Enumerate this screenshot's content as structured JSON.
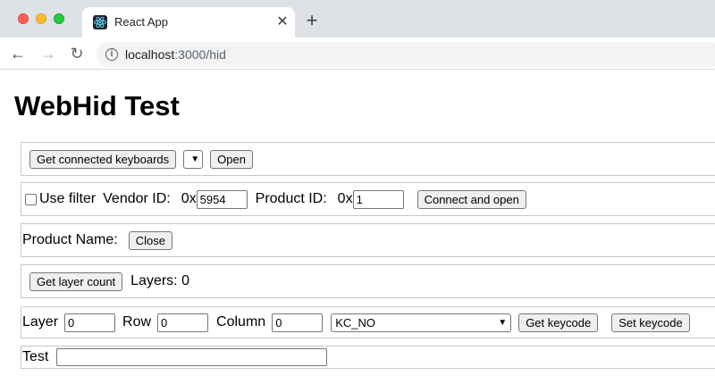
{
  "browser": {
    "tab_title": "React App",
    "tab_close": "✕",
    "new_tab": "+",
    "url_host": "localhost",
    "url_path": ":3000/hid",
    "back": "←",
    "forward": "→",
    "reload": "↻",
    "info": "i"
  },
  "page": {
    "title": "WebHid Test"
  },
  "row1": {
    "get_keyboards_label": "Get connected keyboards",
    "device_select_value": "",
    "open_label": "Open"
  },
  "row2": {
    "use_filter_label": "Use filter",
    "vendor_label": "Vendor ID:",
    "vendor_prefix": "0x",
    "vendor_value": "5954",
    "product_label": "Product ID:",
    "product_prefix": "0x",
    "product_value": "1",
    "connect_label": "Connect and open"
  },
  "row3": {
    "product_name_label": "Product Name:",
    "close_label": "Close"
  },
  "row4": {
    "get_layer_count_label": "Get layer count",
    "layers_text": "Layers: 0"
  },
  "row5": {
    "layer_label": "Layer",
    "layer_value": "0",
    "row_label": "Row",
    "row_value": "0",
    "column_label": "Column",
    "column_value": "0",
    "keycode_value": "KC_NO",
    "get_keycode_label": "Get keycode",
    "set_keycode_label": "Set keycode"
  },
  "row6": {
    "test_label": "Test",
    "test_value": ""
  },
  "icons": {
    "favicon": "react-logo-icon",
    "checkbox": "checkbox-icon",
    "chevron": "chevron-down-icon"
  }
}
